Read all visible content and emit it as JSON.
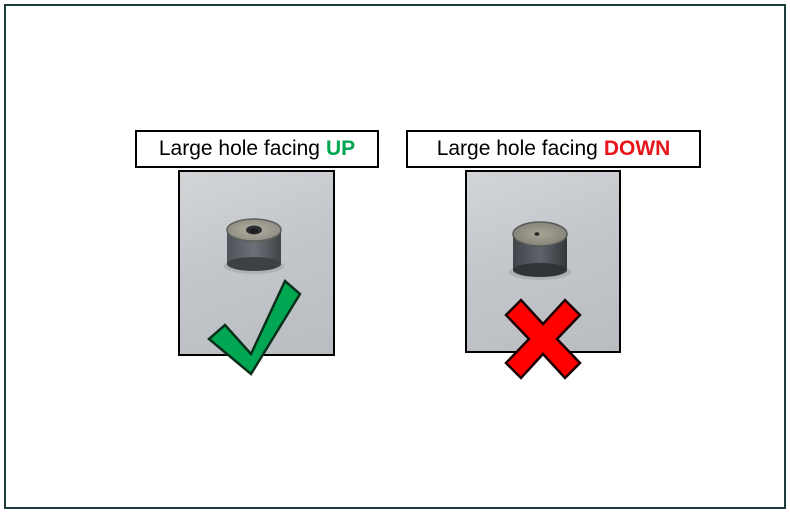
{
  "panels": [
    {
      "label_prefix": "Large hole facing",
      "label_emphasis": "UP",
      "emphasis_color": "#00a651",
      "mark_icon": "checkmark-icon",
      "mark_color": "#00a651"
    },
    {
      "label_prefix": "Large hole facing",
      "label_emphasis": "DOWN",
      "emphasis_color": "#e8161b",
      "mark_icon": "cross-icon",
      "mark_color": "#ff0000"
    }
  ]
}
